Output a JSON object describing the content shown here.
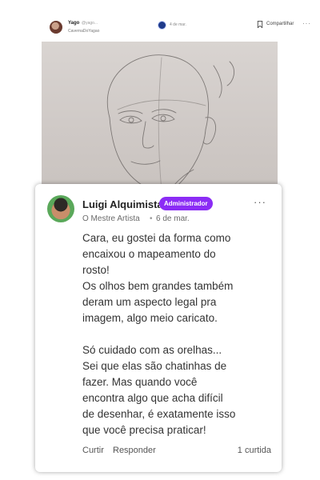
{
  "post": {
    "author": "Yago",
    "handle": "@yago...",
    "subtitle": "CavernaDoYagao",
    "date": "4 de mar.",
    "share_label": "Compartilhar",
    "more": "···"
  },
  "comment": {
    "author": "Luigi Alquimista",
    "badge": "Administrador",
    "author_title": "O Mestre Artista",
    "separator": "•",
    "date": "6 de mar.",
    "more": "···",
    "paragraph1_lines": [
      "Cara, eu gostei da forma como",
      "encaixou o mapeamento do",
      "rosto!",
      "Os olhos bem grandes também",
      "deram um aspecto legal pra",
      "imagem, algo meio caricato."
    ],
    "paragraph2_lines": [
      "Só cuidado com as orelhas...",
      "Sei que elas são chatinhas de",
      "fazer. Mas quando você",
      "encontra algo que acha difícil",
      "de desenhar, é exatamente isso",
      "que você precisa praticar!"
    ],
    "actions": {
      "like": "Curtir",
      "reply": "Responder",
      "like_count": "1 curtida"
    }
  },
  "colors": {
    "badge": "#8b2cf5",
    "text": "#333333",
    "muted": "#6b6b6b"
  },
  "icons": {
    "post_avatar": "user-avatar",
    "badge": "community-badge-icon",
    "bookmark": "bookmark-icon",
    "comment_avatar": "user-avatar"
  }
}
